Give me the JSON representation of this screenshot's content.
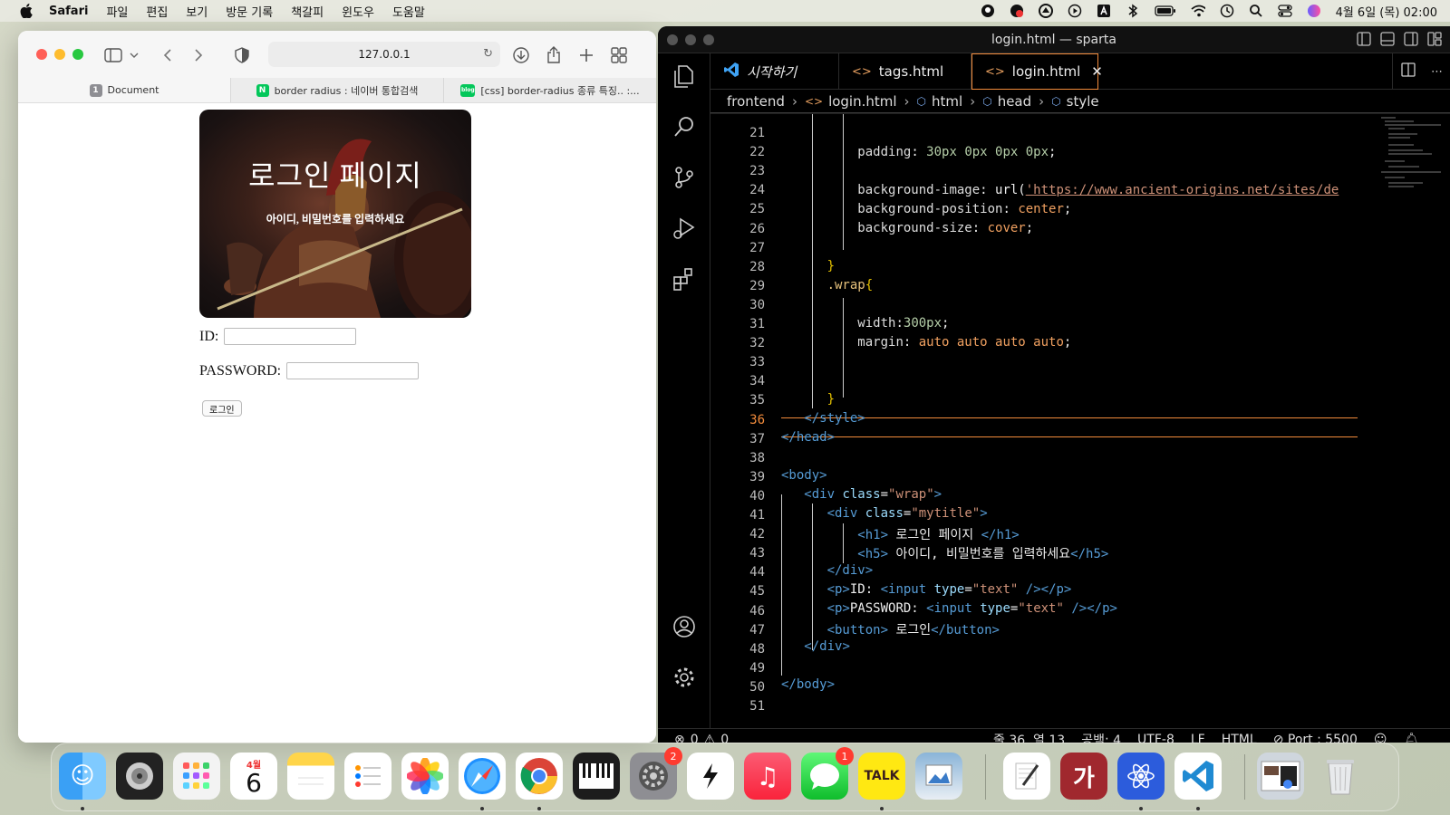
{
  "menubar": {
    "app": "Safari",
    "items": [
      "파일",
      "편집",
      "보기",
      "방문 기록",
      "책갈피",
      "윈도우",
      "도움말"
    ],
    "clock": "4월 6일 (목) 02:00"
  },
  "safari": {
    "url": "127.0.0.1",
    "tabs": [
      {
        "label": "Document",
        "fav": "1"
      },
      {
        "label": "border radius : 네이버 통합검색",
        "fav": "N"
      },
      {
        "label": "[css] border-radius 종류 특징.. :...",
        "fav": "blog"
      }
    ],
    "page": {
      "title": "로그인 페이지",
      "subtitle": "아이디, 비밀번호를 입력하세요",
      "id_label": "ID:",
      "pw_label": "PASSWORD:",
      "button": "로그인"
    }
  },
  "vscode": {
    "title": "login.html — sparta",
    "tabs": [
      "시작하기",
      "tags.html",
      "login.html"
    ],
    "breadcrumb": [
      "frontend",
      "login.html",
      "html",
      "head",
      "style"
    ],
    "status": {
      "errors": "0",
      "warnings": "0",
      "position": "줄 36, 열 13",
      "spaces": "공백: 4",
      "encoding": "UTF-8",
      "eol": "LF",
      "language": "HTML",
      "port": "Port : 5500"
    },
    "lines": [
      "21",
      "22",
      "23",
      "24",
      "25",
      "26",
      "27",
      "28",
      "29",
      "30",
      "31",
      "32",
      "33",
      "34",
      "35",
      "36",
      "37",
      "38",
      "39",
      "40",
      "41",
      "42",
      "43",
      "44",
      "45",
      "46",
      "47",
      "48",
      "49",
      "50",
      "51"
    ]
  },
  "dock": {
    "calendar_month": "4월",
    "calendar_day": "6",
    "settings_badge": "2",
    "messages_badge": "1",
    "talk_label": "TALK",
    "ga_label": "가"
  }
}
